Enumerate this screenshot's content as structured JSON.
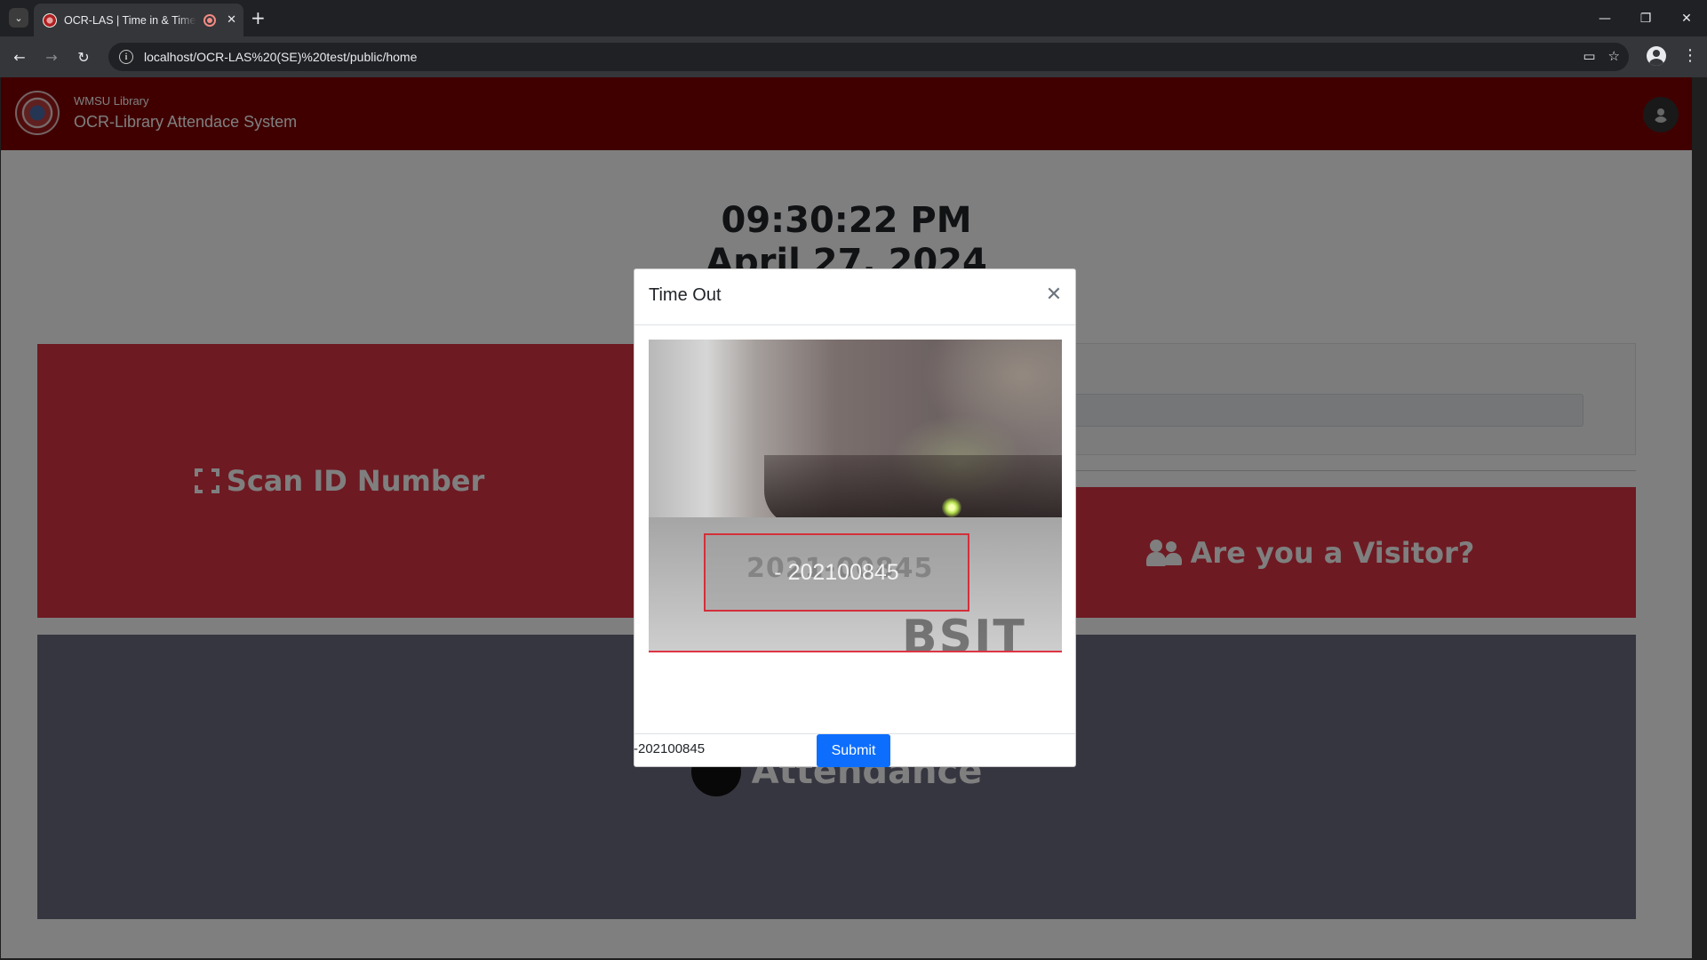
{
  "browser": {
    "tab_title": "OCR-LAS | Time in & Time out",
    "url": "localhost/OCR-LAS%20(SE)%20test/public/home",
    "new_tab_glyph": "+",
    "tab_close_glyph": "✕"
  },
  "header": {
    "org": "WMSU Library",
    "system_name": "OCR-Library Attendace System"
  },
  "clock": {
    "time": "09:30:22 PM",
    "date": "April 27, 2024"
  },
  "panels": {
    "scan_label": "Scan ID Number",
    "visitor_label": "Are you a Visitor?",
    "attendance_label": "Attendance"
  },
  "modal": {
    "title": "Time Out",
    "ocr_detected_text": "- 202100845",
    "camera_blur_text": "2021-00845",
    "camera_bsit_text": "BSIT",
    "id_value": "-202100845",
    "submit_label": "Submit"
  },
  "colors": {
    "header_maroon": "#800000",
    "panel_red": "#dc3545",
    "primary_blue": "#0d6efd",
    "attendance_gray": "#6c6c80"
  },
  "icons": [
    "chevron-down-icon",
    "favicon-icon",
    "record-icon",
    "close-icon",
    "plus-icon",
    "minimize-icon",
    "restore-icon",
    "back-icon",
    "forward-icon",
    "reload-icon",
    "info-icon",
    "camera-icon",
    "star-icon",
    "profile-icon",
    "kebab-icon",
    "logo-icon",
    "user-icon",
    "scan-icon",
    "users-icon",
    "chevron-up-icon"
  ]
}
